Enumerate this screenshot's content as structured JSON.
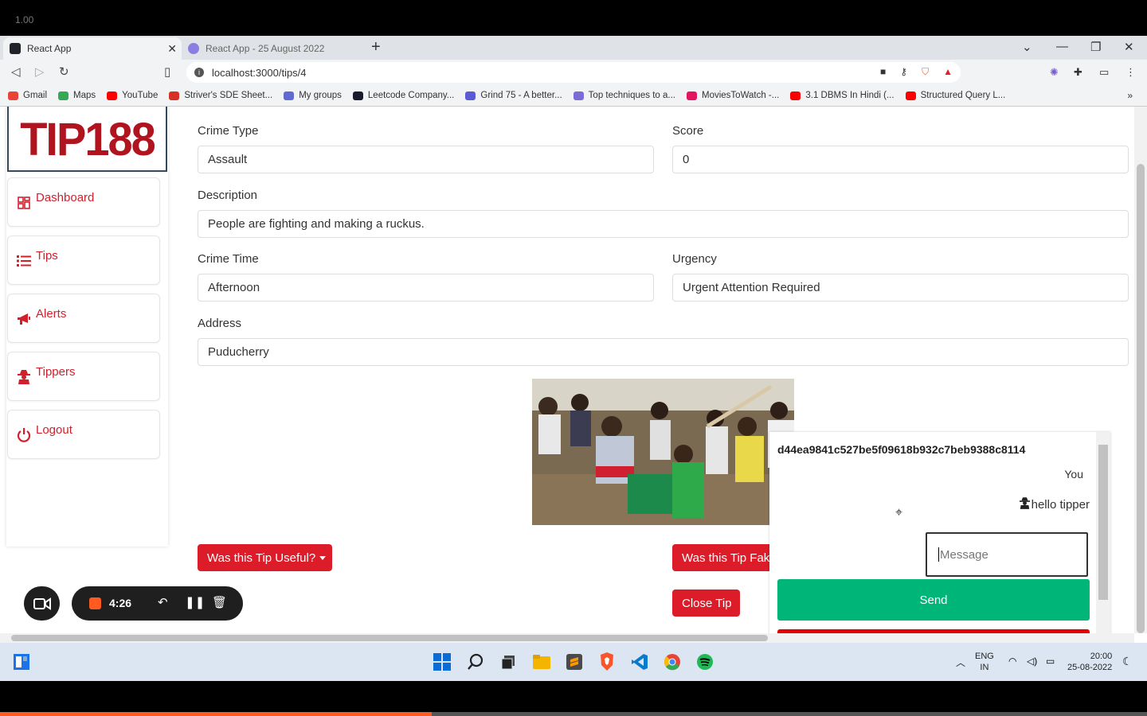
{
  "screen": {
    "top_label": "1.00"
  },
  "browser": {
    "tabs": [
      {
        "title": "React App",
        "active": true
      },
      {
        "title": "React App - 25 August 2022",
        "active": false
      }
    ],
    "url": "localhost:3000/tips/4",
    "bookmarks": [
      {
        "label": "Gmail",
        "color": "#ea4335"
      },
      {
        "label": "Maps",
        "color": "#34a853"
      },
      {
        "label": "YouTube",
        "color": "#ff0000"
      },
      {
        "label": "Striver's SDE Sheet...",
        "color": "#d93025"
      },
      {
        "label": "My groups",
        "color": "#5f6bd1"
      },
      {
        "label": "Leetcode Company...",
        "color": "#1a1a2e"
      },
      {
        "label": "Grind 75 - A better...",
        "color": "#5b5bd6"
      },
      {
        "label": "Top techniques to a...",
        "color": "#7b6ad8"
      },
      {
        "label": "MoviesToWatch -...",
        "color": "#e5145e"
      },
      {
        "label": "3.1 DBMS In Hindi (...",
        "color": "#ff0000"
      },
      {
        "label": "Structured Query L...",
        "color": "#ff0000"
      }
    ],
    "bookmarks_more": "»"
  },
  "app": {
    "logo_text": "TIP188",
    "brand_color": "#dc1c28",
    "nav": [
      {
        "label": "Dashboard",
        "icon": "dashboard-icon"
      },
      {
        "label": "Tips",
        "icon": "list-icon"
      },
      {
        "label": "Alerts",
        "icon": "megaphone-icon"
      },
      {
        "label": "Tippers",
        "icon": "user-secret-icon"
      },
      {
        "label": "Logout",
        "icon": "power-icon"
      }
    ],
    "form": {
      "crime_type_label": "Crime Type",
      "crime_type_value": "Assault",
      "score_label": "Score",
      "score_value": "0",
      "description_label": "Description",
      "description_value": "People are fighting and making a ruckus.",
      "crime_time_label": "Crime Time",
      "crime_time_value": "Afternoon",
      "urgency_label": "Urgency",
      "urgency_value": "Urgent Attention Required",
      "address_label": "Address",
      "address_value": "Puducherry"
    },
    "buttons": {
      "useful": "Was this Tip Useful?",
      "fake": "Was this Tip Fake",
      "close": "Close Tip"
    },
    "chat": {
      "tipper_id": "d44ea9841c527be5f09618b932c7beb9388c8114",
      "sender_label": "You",
      "message_text": "hello tipper",
      "input_placeholder": "Message",
      "send_label": "Send"
    }
  },
  "recorder": {
    "elapsed": "4:26",
    "accent": "#ff5a1f"
  },
  "taskbar": {
    "lang_top": "ENG",
    "lang_bottom": "IN",
    "time": "20:00",
    "date": "25-08-2022"
  }
}
